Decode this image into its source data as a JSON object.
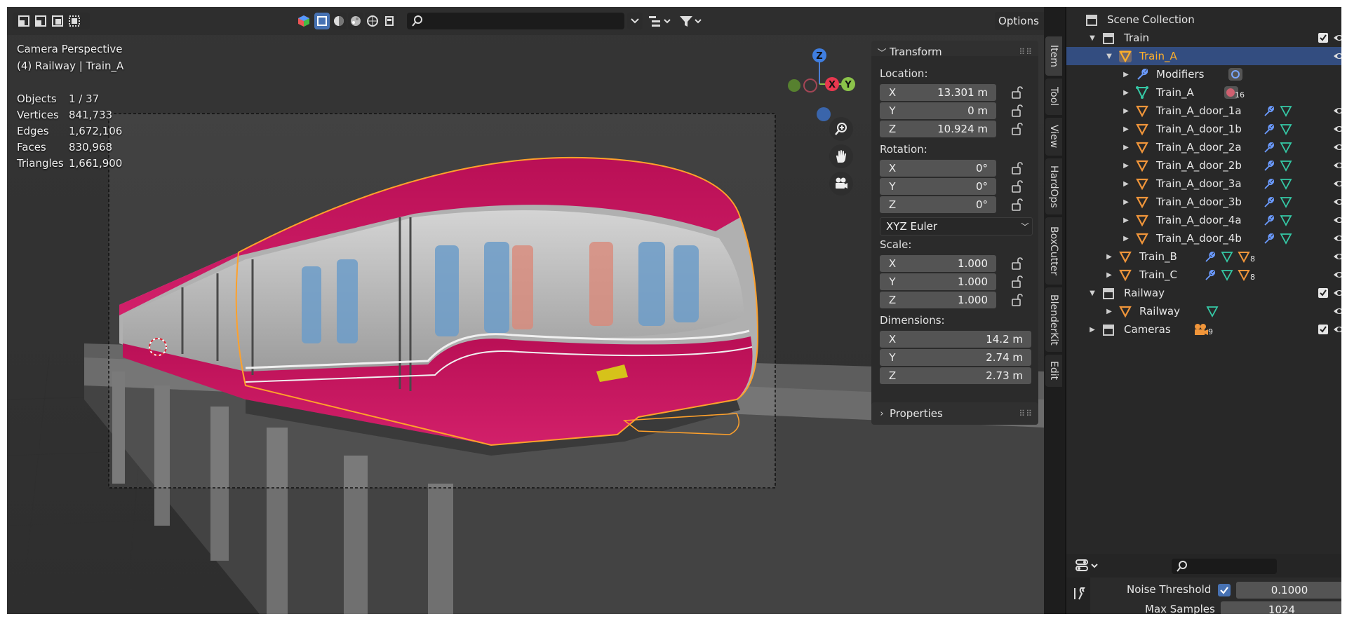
{
  "viewport": {
    "overlay": {
      "line1": "Camera Perspective",
      "line2": "(4) Railway | Train_A"
    },
    "stats": [
      {
        "label": "Objects",
        "value": "1 / 37"
      },
      {
        "label": "Vertices",
        "value": "841,733"
      },
      {
        "label": "Edges",
        "value": "1,672,106"
      },
      {
        "label": "Faces",
        "value": "830,968"
      },
      {
        "label": "Triangles",
        "value": "1,661,900"
      }
    ],
    "options_label": "Options",
    "gizmo": {
      "z": "Z",
      "x": "X",
      "y": "Y"
    }
  },
  "transform": {
    "title": "Transform",
    "location_label": "Location:",
    "location": [
      {
        "axis": "X",
        "value": "13.301 m"
      },
      {
        "axis": "Y",
        "value": "0 m"
      },
      {
        "axis": "Z",
        "value": "10.924 m"
      }
    ],
    "rotation_label": "Rotation:",
    "rotation": [
      {
        "axis": "X",
        "value": "0°"
      },
      {
        "axis": "Y",
        "value": "0°"
      },
      {
        "axis": "Z",
        "value": "0°"
      }
    ],
    "rotation_mode": "XYZ Euler",
    "scale_label": "Scale:",
    "scale": [
      {
        "axis": "X",
        "value": "1.000"
      },
      {
        "axis": "Y",
        "value": "1.000"
      },
      {
        "axis": "Z",
        "value": "1.000"
      }
    ],
    "dimensions_label": "Dimensions:",
    "dimensions": [
      {
        "axis": "X",
        "value": "14.2 m"
      },
      {
        "axis": "Y",
        "value": "2.74 m"
      },
      {
        "axis": "Z",
        "value": "2.73 m"
      }
    ]
  },
  "properties_panel": {
    "title": "Properties"
  },
  "side_tabs": [
    "Item",
    "Tool",
    "View",
    "HardOps",
    "BoxCutter",
    "BlenderKit",
    "Edit"
  ],
  "outliner": {
    "scene_collection": "Scene Collection",
    "rows": [
      {
        "name": "Train"
      },
      {
        "name": "Train_A"
      },
      {
        "name": "Modifiers"
      },
      {
        "name": "Train_A",
        "badge": "16"
      },
      {
        "name": "Train_A_door_1a"
      },
      {
        "name": "Train_A_door_1b"
      },
      {
        "name": "Train_A_door_2a"
      },
      {
        "name": "Train_A_door_2b"
      },
      {
        "name": "Train_A_door_3a"
      },
      {
        "name": "Train_A_door_3b"
      },
      {
        "name": "Train_A_door_4a"
      },
      {
        "name": "Train_A_door_4b"
      },
      {
        "name": "Train_B",
        "badge": "8"
      },
      {
        "name": "Train_C",
        "badge": "8"
      },
      {
        "name": "Railway"
      },
      {
        "name": "Railway"
      },
      {
        "name": "Cameras",
        "badge": "9"
      }
    ]
  },
  "render_props": {
    "noise_threshold_label": "Noise Threshold",
    "noise_threshold_value": "0.1000",
    "max_samples_label": "Max Samples",
    "max_samples_value": "1024"
  },
  "colors": {
    "accent": "#4772b3",
    "selection_outline": "#ffa12b",
    "train_body": "#c5135a",
    "outliner_selected": "#334d80"
  }
}
